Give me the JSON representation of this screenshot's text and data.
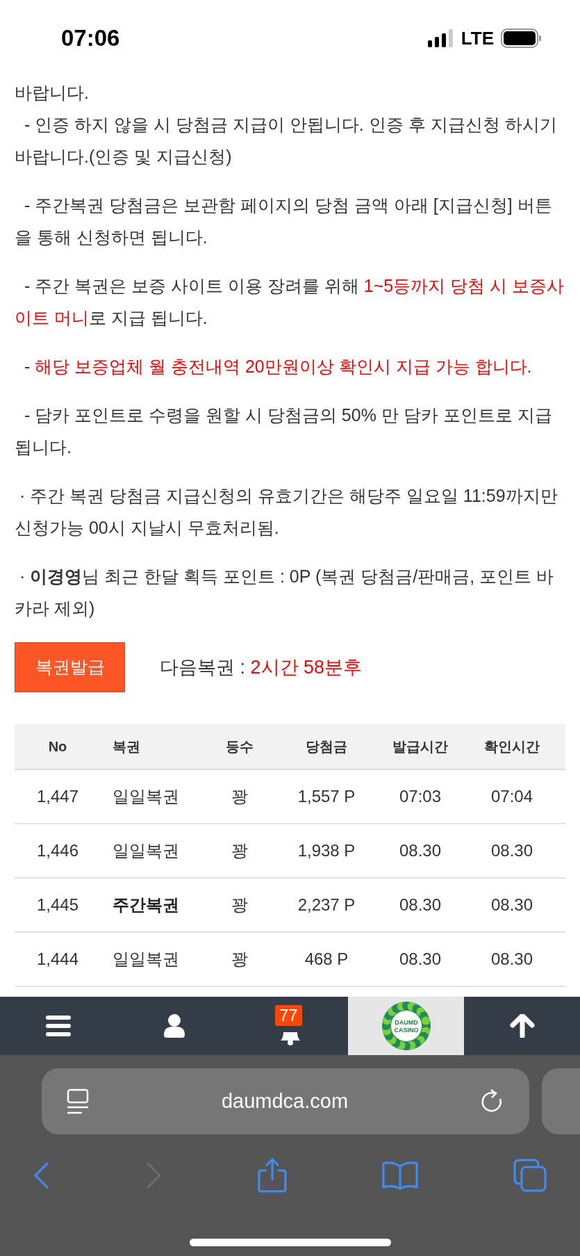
{
  "status_bar": {
    "time": "07:06",
    "network": "LTE"
  },
  "paragraphs": [
    {
      "segments": [
        {
          "text": "바랍니다.\n  - 인증 하지 않을 시 당첨금 지급이 안됩니다. 인증 후 지급신청 하시기 바랍니다.(인증 및 지급신청)",
          "highlight": false
        }
      ]
    },
    {
      "segments": [
        {
          "text": "  - 주간복권 당첨금은 보관함 페이지의 당첨 금액 아래 [지급신청] 버튼을 통해 신청하면 됩니다.",
          "highlight": false
        }
      ]
    },
    {
      "segments": [
        {
          "text": "  - 주간 복권은 보증 사이트 이용 장려를 위해 ",
          "highlight": false
        },
        {
          "text": "1~5등까지 당첨 시 보증사이트 머니",
          "highlight": true
        },
        {
          "text": "로 지급 됩니다.",
          "highlight": false
        }
      ]
    },
    {
      "segments": [
        {
          "text": "  - ",
          "highlight": false
        },
        {
          "text": "해당 보증업체 월 충전내역 20만원이상 확인시 지급 가능 합니다.",
          "highlight": true
        }
      ]
    },
    {
      "segments": [
        {
          "text": "  - 담카 포인트로 수령을 원할 시 당첨금의 50% 만 담카 포인트로 지급 됩니다.",
          "highlight": false
        }
      ]
    },
    {
      "segments": [
        {
          "text": " · 주간 복권 당첨금 지급신청의 유효기간은 해당주 일요일 11:59까지만 신청가능 00시 지날시 무효처리됨.",
          "highlight": false
        }
      ]
    },
    {
      "segments": [
        {
          "text": " · **이경영**님 최근 한달 획득 포인트 : 0P (복권 당첨금/판매금, 포인트 바카라 제외)",
          "highlight": false
        }
      ]
    }
  ],
  "issue_button": "복권발급",
  "next_lottery": {
    "label": "다음복권 : ",
    "value": "2시간 58분후"
  },
  "table": {
    "columns": [
      "No",
      "복권",
      "등수",
      "당첨금",
      "발급시간",
      "확인시간"
    ],
    "rows": [
      {
        "cells": [
          "1,447",
          "일일복권",
          "꽝",
          "1,557 P",
          "07:03",
          "07:04"
        ],
        "emphasized": false
      },
      {
        "cells": [
          "1,446",
          "일일복권",
          "꽝",
          "1,938 P",
          "08.30",
          "08.30"
        ],
        "emphasized": false
      },
      {
        "cells": [
          "1,445",
          "주간복권",
          "꽝",
          "2,237 P",
          "08.30",
          "08.30"
        ],
        "emphasized": true
      },
      {
        "cells": [
          "1,444",
          "일일복권",
          "꽝",
          "468 P",
          "08.30",
          "08.30"
        ],
        "emphasized": false
      }
    ]
  },
  "bottom_nav": {
    "badge": "77",
    "logo_text": [
      "DAUMD",
      "CASINO"
    ]
  },
  "browser": {
    "url": "daumdca.com"
  }
}
